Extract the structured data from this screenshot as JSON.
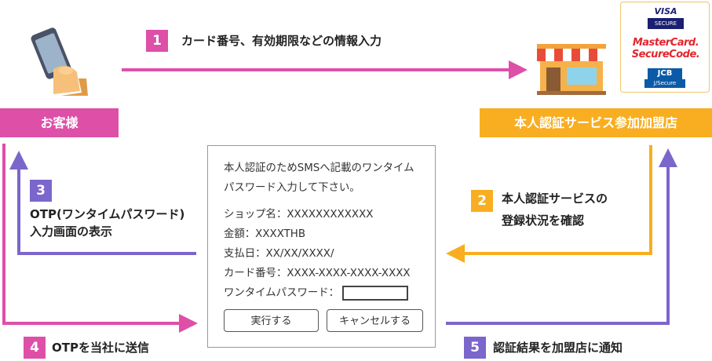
{
  "steps": [
    {
      "num": "1",
      "text": "カード番号、有効期限などの情報入力"
    },
    {
      "num": "2",
      "line1": "本人認証サービスの",
      "line2": "登録状況を確認"
    },
    {
      "num": "3",
      "line1": "OTP(ワンタイムパスワード)",
      "line2": "入力画面の表示"
    },
    {
      "num": "4",
      "text": "OTPを当社に送信"
    },
    {
      "num": "5",
      "text": "認証結果を加盟店に通知"
    }
  ],
  "customer_label": "お客様",
  "merchant_label": "本人認証サービス参加加盟店",
  "panel": {
    "intro1": "本人認証のためSMSへ記載のワンタイム",
    "intro2": "パスワード入力して下さい。",
    "shop": "ショップ名：XXXXXXXXXXXX",
    "amount": "金額：XXXXTHB",
    "payday": "支払日：XX/XX/XXXX/",
    "card": "カード番号：XXXX-XXXX-XXXX-XXXX",
    "otp_label": "ワンタイムパスワード：",
    "execute_label": "実行する",
    "cancel_label": "キャンセルする"
  },
  "logos": {
    "visa": "VISA",
    "visa_sub": "SECURE",
    "mastercard1": "MasterCard.",
    "mastercard2": "SecureCode.",
    "jcb": "JCB",
    "jcb_sub": "J/Secure"
  },
  "colors": {
    "pink": "#de4fa8",
    "orange": "#f8ae20",
    "purple": "#7b66cc"
  }
}
